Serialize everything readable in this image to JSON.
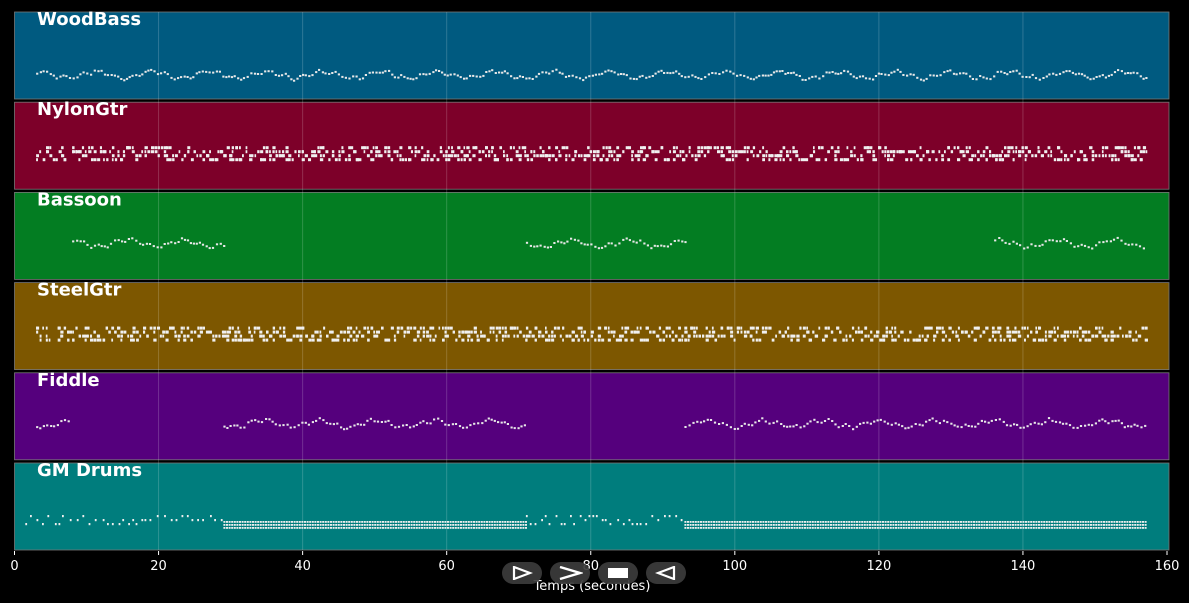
{
  "chart_data": {
    "type": "piano-roll",
    "xlabel": "Temps (secondes)",
    "xlim": [
      0,
      160
    ],
    "x_ticks": [
      "0",
      "20",
      "40",
      "60",
      "80",
      "100",
      "120",
      "140",
      "160"
    ],
    "x_tick_values": [
      0,
      20,
      40,
      60,
      80,
      100,
      120,
      140,
      160
    ],
    "grid": true,
    "tracks": [
      {
        "name": "WoodBass",
        "color": "#005a80",
        "style": "bass",
        "segments": [
          [
            3,
            157
          ]
        ]
      },
      {
        "name": "NylonGtr",
        "color": "#7d0029",
        "style": "dense",
        "segments": [
          [
            3,
            7
          ],
          [
            8,
            157
          ]
        ]
      },
      {
        "name": "Bassoon",
        "color": "#037d22",
        "style": "melody",
        "segments": [
          [
            8,
            29
          ],
          [
            71,
            93
          ],
          [
            136,
            157
          ]
        ]
      },
      {
        "name": "SteelGtr",
        "color": "#7d5700",
        "style": "dense",
        "segments": [
          [
            3,
            5
          ],
          [
            6,
            29
          ],
          [
            29,
            71
          ],
          [
            71,
            93
          ],
          [
            93,
            136
          ],
          [
            136,
            157
          ]
        ]
      },
      {
        "name": "Fiddle",
        "color": "#55007d",
        "style": "melody",
        "segments": [
          [
            3,
            7.5
          ],
          [
            29,
            71
          ],
          [
            93,
            157
          ]
        ]
      },
      {
        "name": "GM Drums",
        "color": "#007d7d",
        "style": "drums",
        "segments": [
          [
            1.5,
            29
          ],
          [
            29,
            71
          ],
          [
            71,
            93
          ],
          [
            93,
            157
          ]
        ]
      }
    ]
  },
  "controls": [
    {
      "name": "rewind",
      "icon": "rewind-icon"
    },
    {
      "name": "play",
      "icon": "play-icon"
    },
    {
      "name": "stop",
      "icon": "stop-icon"
    },
    {
      "name": "back",
      "icon": "back-icon"
    }
  ]
}
